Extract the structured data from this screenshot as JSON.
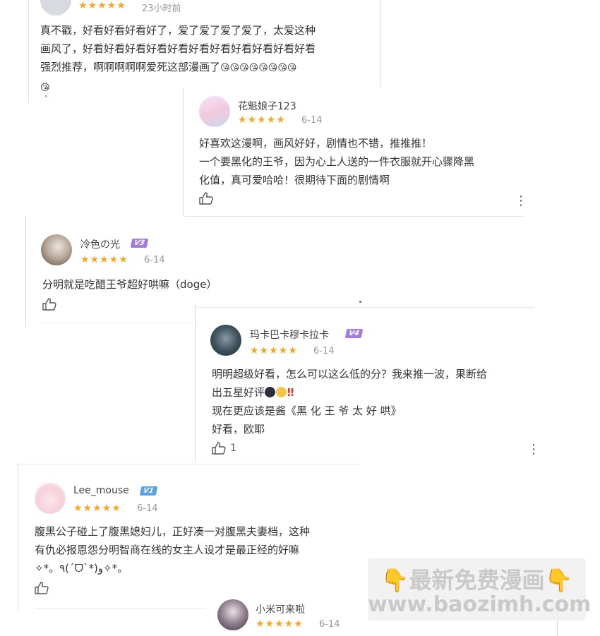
{
  "comments": [
    {
      "stars": "★★★★★",
      "date": "23小时前",
      "lines": [
        "真不戳，好看好看好看好了，爱了爱了爱了爱了，太爱这种",
        "画风了，好看好看好看好看好看好看好看好看好看好看好看",
        "强烈推荐，啊啊啊啊啊爱死这部漫画了"
      ],
      "emoji_tail": "😘😘😘😘😘😘😘😘",
      "last_line_emoji": "😘",
      "caret": "˄"
    },
    {
      "username": "花魁娘子123",
      "stars": "★★★★★",
      "date": "6-14",
      "lines": [
        "好喜欢这漫啊，画风好好，剧情也不错，推推推！",
        "一个要黑化的王爷，因为心上人送的一件衣服就开心骤降黑",
        "化值，真可爱哈哈！很期待下面的剧情啊"
      ],
      "more": "⋮"
    },
    {
      "username": "冷色の光",
      "vip": "V3",
      "stars": "★★★★★",
      "date": "6-14",
      "lines": [
        "分明就是吃醋王爷超好哄嘛（doge）"
      ]
    },
    {
      "username": "玛卡巴卡穆卡拉卡",
      "vip": "V4",
      "stars": "★★★★★",
      "date": "6-14",
      "lines": [
        "明明超级好看，怎么可以这么低的分？我来推一波，果断给",
        "出五星好评",
        "现在更应该是酱《黑 化 王 爷 太 好 哄》",
        "好看，欧耶"
      ],
      "exclaim": "‼",
      "likes": "1",
      "more": "⋮"
    },
    {
      "username": "Lee_mouse",
      "vip": "V1",
      "stars": "★★★★★",
      "date": "6-14",
      "lines": [
        "腹黑公子碰上了腹黑媳妇儿，正好凑一对腹黑夫妻档，这种",
        "有仇必报恩怨分明智商在线的女主人设才是最正经的好嘛",
        "✧*。٩(ˊᗜˋ*)و✧*。"
      ]
    },
    {
      "username": "小米可来啦",
      "stars": "★★★★★",
      "date": "6-14"
    }
  ],
  "watermark": {
    "line1": "最新免费漫画",
    "hand": "👇",
    "line2": "www.baozimh.com"
  },
  "colors": {
    "star": "#f5a623",
    "vip_v1": "#5aa0e6",
    "vip_purple": "#a27be0"
  }
}
